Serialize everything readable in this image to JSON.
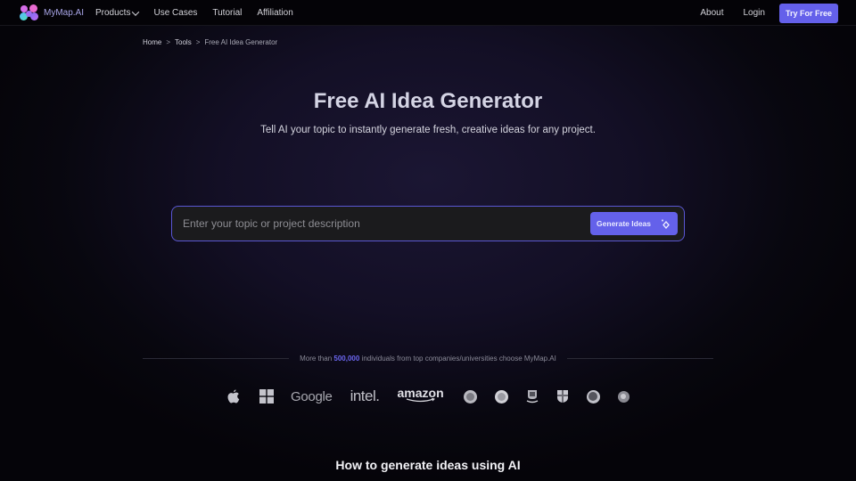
{
  "nav": {
    "brand": "MyMap.AI",
    "links": [
      {
        "label": "Products",
        "has_dropdown": true
      },
      {
        "label": "Use Cases"
      },
      {
        "label": "Tutorial"
      },
      {
        "label": "Affiliation"
      }
    ],
    "about": "About",
    "login": "Login",
    "cta": "Try For Free"
  },
  "breadcrumb": {
    "home": "Home",
    "tools": "Tools",
    "current": "Free AI Idea Generator",
    "separator": ">"
  },
  "hero": {
    "title": "Free AI Idea Generator",
    "subtitle": "Tell AI your topic to instantly generate fresh, creative ideas for any project."
  },
  "search": {
    "placeholder": "Enter your topic or project description",
    "value": "",
    "button_label": "Generate Ideas",
    "button_icon": "sparkle-diamond-icon"
  },
  "trust": {
    "prefix": "More than",
    "count": "500,000",
    "suffix": "individuals from top companies/universities choose MyMap.AI",
    "logos": [
      {
        "name": "apple-logo"
      },
      {
        "name": "microsoft-logo"
      },
      {
        "name": "google-logo",
        "text": "Google"
      },
      {
        "name": "intel-logo",
        "text": "intel."
      },
      {
        "name": "amazon-logo",
        "text": "amazon"
      },
      {
        "name": "university-seal-1"
      },
      {
        "name": "university-seal-2"
      },
      {
        "name": "university-crest-3"
      },
      {
        "name": "university-shield-4"
      },
      {
        "name": "university-seal-5"
      },
      {
        "name": "university-seal-6"
      }
    ]
  },
  "section": {
    "howto_title": "How to generate ideas using AI"
  },
  "colors": {
    "accent": "#6461ea",
    "border_accent": "#5a57d4",
    "highlight": "#6b67f0",
    "background_center": "#1b1633",
    "background_edge": "#050409"
  }
}
